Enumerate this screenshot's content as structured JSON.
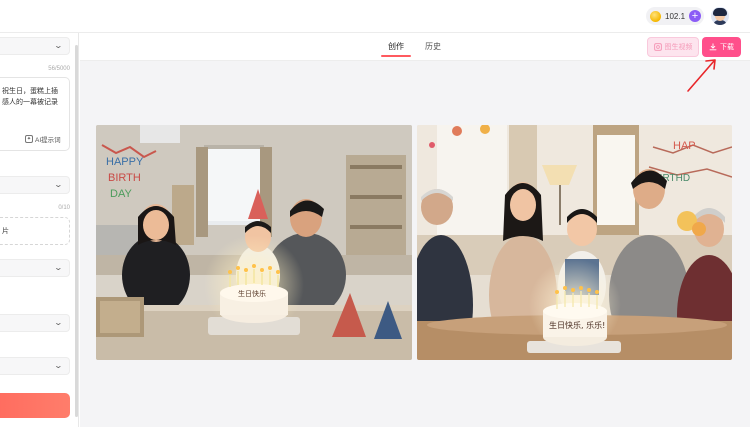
{
  "header": {
    "credits": "102.1",
    "add_credits_icon": "+"
  },
  "left_panel": {
    "prompt_counter": "56/5000",
    "prompt_text_line1": "祝生日，蛋糕上插",
    "prompt_text_line2": "感人的一幕被记录",
    "ai_hint_label": "AI提示词",
    "upload_counter": "0/10",
    "upload_label": "片"
  },
  "tabs": [
    {
      "label": "创作",
      "active": true
    },
    {
      "label": "历史",
      "active": false
    }
  ],
  "actions": {
    "video_label": "图生视频",
    "download_label": "下载"
  },
  "images": [
    {
      "alt": "family-birthday-photo-1",
      "cake_text": "生日快乐"
    },
    {
      "alt": "family-birthday-photo-2",
      "cake_text": "生日快乐, 乐乐!"
    }
  ],
  "colors": {
    "accent": "#ff4f8b",
    "tab_underline": "#ff5a5f",
    "generate_button": "#ff6b5e",
    "plus_button": "#8b5cf6"
  }
}
